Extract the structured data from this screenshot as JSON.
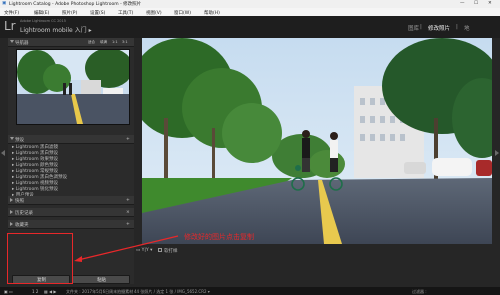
{
  "window": {
    "title": "Lightroom Catalog - Adobe Photoshop Lightroom - 修改照片",
    "controls": [
      "—",
      "☐",
      "✕"
    ]
  },
  "menu": [
    "文件(F)",
    "编辑(E)",
    "照片(P)",
    "设置(S)",
    "工具(T)",
    "视图(V)",
    "窗口(W)",
    "帮助(H)"
  ],
  "identity": {
    "logo": "Lr",
    "version": "Adobe Lightroom CC 2015",
    "mobile": "Lightroom mobile 入门 ▸",
    "modules": [
      "图库",
      "修改照片",
      "地"
    ]
  },
  "left_panel": {
    "navigator": {
      "title": "导航器",
      "options": [
        "适合",
        "填满",
        "1:1",
        "3:1"
      ]
    },
    "presets": {
      "title": "预设",
      "items": [
        "Lightroom 黑白滤镜",
        "Lightroom 黑白预设",
        "Lightroom 效果预设",
        "Lightroom 颜色预设",
        "Lightroom 常规预设",
        "Lightroom 黑白色调预设",
        "Lightroom 视频预设",
        "Lightroom 锐化预设",
        "用户预设"
      ]
    },
    "snapshots": {
      "title": "快照"
    },
    "history": {
      "title": "历史记录"
    },
    "collections": {
      "title": "收藏夹"
    }
  },
  "buttons": {
    "copy": "复制",
    "paste": "粘贴"
  },
  "toolbar": {
    "view_label": "▭ Y|Y ▾",
    "soft_proof": "软打样"
  },
  "annotation": {
    "text": "修改好的图片点击复制",
    "color": "#e8282a"
  },
  "filmstrip": {
    "pages": "1  2",
    "source": "文件夹 : 2017年5月6日周末拍摄素材",
    "count": "44 张照片 / 选定 1 张 / IMG_5652.CR2 ▾",
    "filter_label": "过滤器 :"
  }
}
